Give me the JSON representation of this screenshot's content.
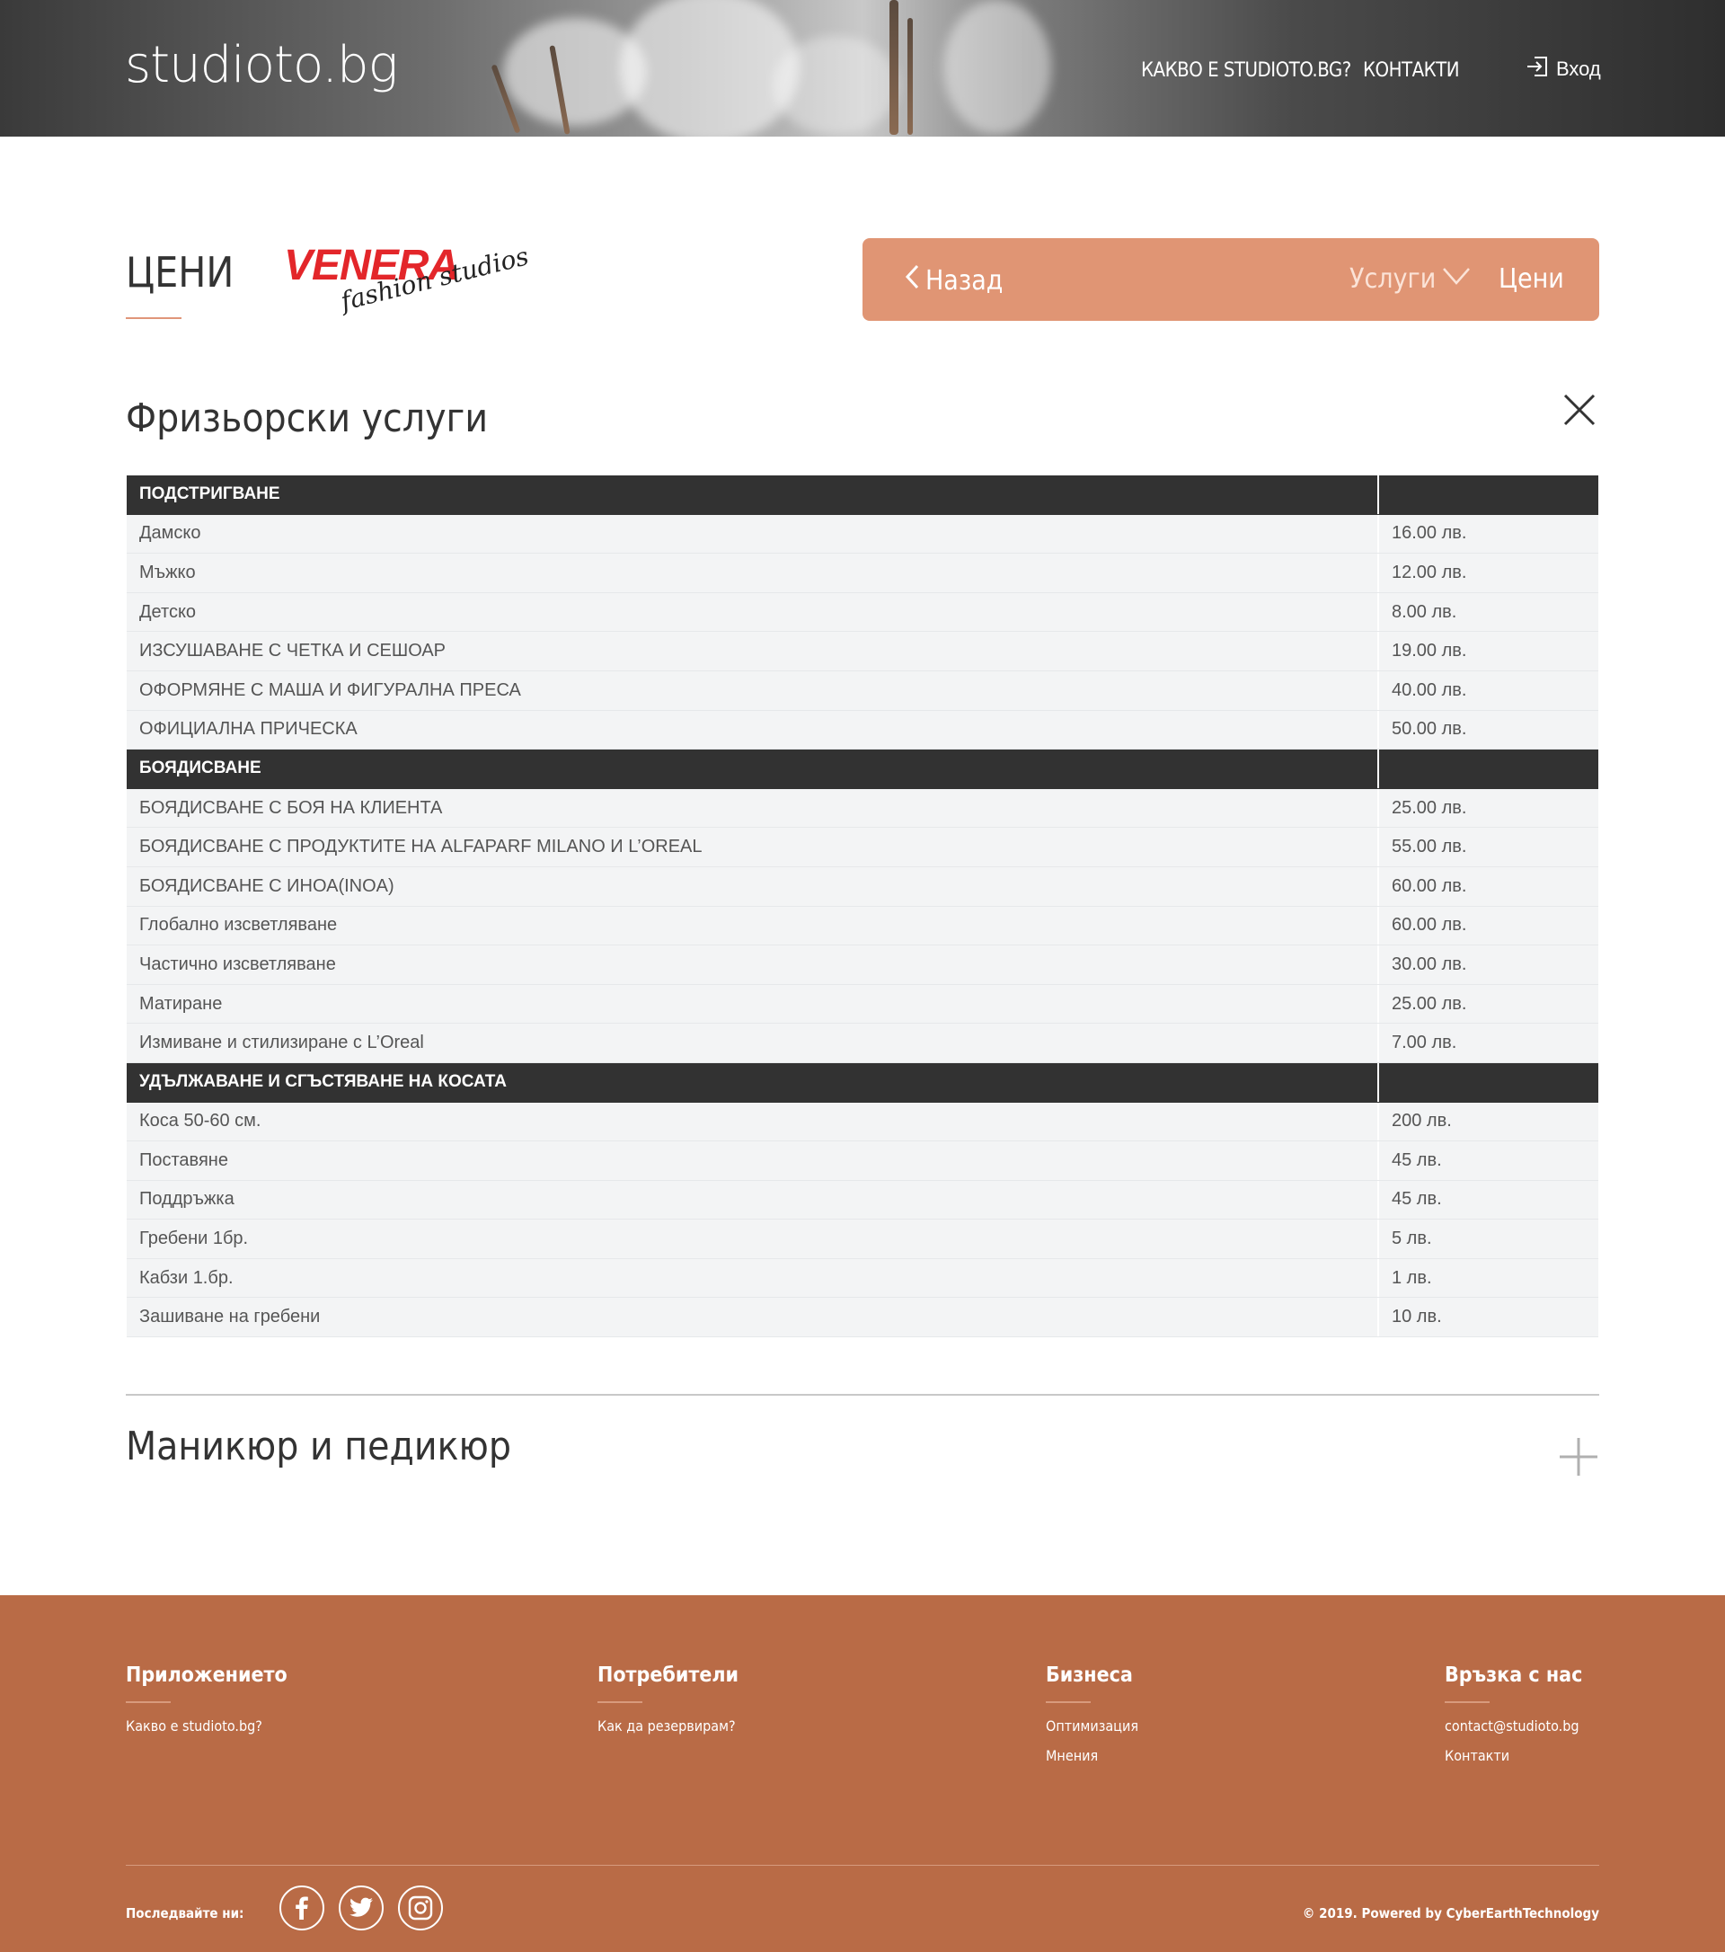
{
  "header": {
    "logo": "studioto.bg",
    "nav": [
      "КАКВО Е STUDIOTO.BG?",
      "КОНТАКТИ"
    ],
    "login": "Вход"
  },
  "page": {
    "title": "ЦЕНИ",
    "brand_main": "VENERA",
    "brand_sub": "fashion studios"
  },
  "subnav": {
    "back": "Назад",
    "services": "Услуги",
    "prices": "Цени",
    "color": "#e09574"
  },
  "section1": {
    "title": "Фризьорски услуги",
    "groups": [
      {
        "name": "ПОДСТРИГВАНЕ",
        "items": [
          {
            "name": "Дамско",
            "price": "16.00 лв."
          },
          {
            "name": "Мъжко",
            "price": "12.00 лв."
          },
          {
            "name": "Детско",
            "price": "8.00 лв."
          },
          {
            "name": "ИЗСУШАВАНЕ С ЧЕТКА И СЕШОАР",
            "price": "19.00 лв."
          },
          {
            "name": "ОФОРМЯНЕ С МАША И ФИГУРАЛНА ПРЕСА",
            "price": "40.00 лв."
          },
          {
            "name": "ОФИЦИАЛНА ПРИЧЕСКА",
            "price": "50.00 лв."
          }
        ]
      },
      {
        "name": "БОЯДИСВАНЕ",
        "items": [
          {
            "name": "БОЯДИСВАНЕ С БОЯ НА КЛИЕНТА",
            "price": "25.00 лв."
          },
          {
            "name": "БОЯДИСВАНЕ С ПРОДУКТИТЕ НА ALFAPARF MILANO И L’OREAL",
            "price": "55.00 лв."
          },
          {
            "name": "БОЯДИСВАНЕ С ИНОА(INOA)",
            "price": "60.00 лв."
          },
          {
            "name": "Глобално изсветляване",
            "price": "60.00 лв."
          },
          {
            "name": "Частично изсветляване",
            "price": "30.00 лв."
          },
          {
            "name": "Матиране",
            "price": "25.00 лв."
          },
          {
            "name": "Измиване и стилизиране с L’Oreal",
            "price": "7.00 лв."
          }
        ]
      },
      {
        "name": "УДЪЛЖАВАНЕ И СГЪСТЯВАНЕ НА КОСАТА",
        "items": [
          {
            "name": "Коса 50-60 см.",
            "price": "200 лв."
          },
          {
            "name": "Поставяне",
            "price": "45 лв."
          },
          {
            "name": "Поддръжка",
            "price": "45 лв."
          },
          {
            "name": "Гребени 1бр.",
            "price": "5 лв."
          },
          {
            "name": "Кабзи 1.бр.",
            "price": "1 лв."
          },
          {
            "name": "Зашиване на гребени",
            "price": "10 лв."
          }
        ]
      }
    ]
  },
  "section2": {
    "title": "Маникюр и педикюр"
  },
  "footer": {
    "columns": [
      {
        "title": "Приложението",
        "links": [
          "Какво е studioto.bg?"
        ]
      },
      {
        "title": "Потребители",
        "links": [
          "Как да резервирам?"
        ]
      },
      {
        "title": "Бизнеса",
        "links": [
          "Оптимизация",
          "Мнения"
        ]
      },
      {
        "title": "Връзка с нас",
        "links": [
          "contact@studioto.bg",
          "Контакти"
        ]
      }
    ],
    "follow": "Последвайте ни:",
    "social_icons": [
      "facebook-icon",
      "twitter-icon",
      "instagram-icon"
    ],
    "copyright": "© 2019. Powered by CyberEarthTechnology",
    "color": "#b96b46"
  }
}
